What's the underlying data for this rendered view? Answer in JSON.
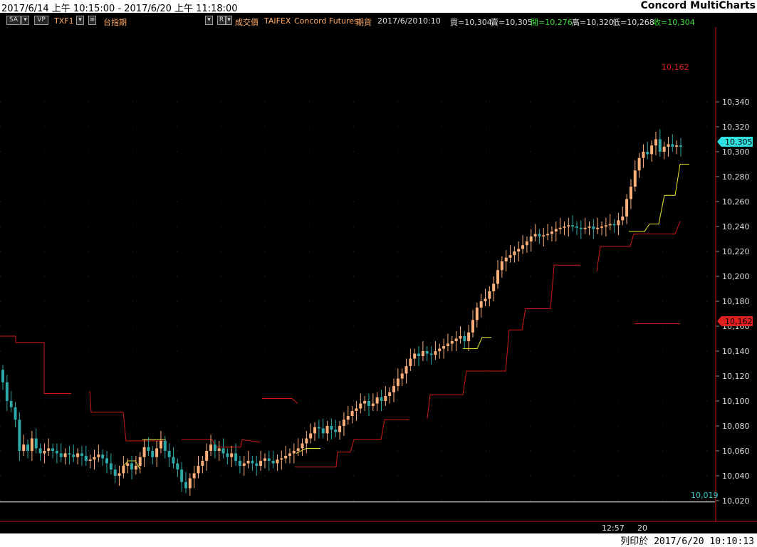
{
  "title_bar": {
    "date_range": "2017/6/14 上午 10:15:00 - 2017/6/20 上午 11:18:00",
    "app_name": "Concord MultiCharts"
  },
  "toolbar": {
    "btn_sa": "SA",
    "btn_vp": "VP",
    "symbol": "TXF1",
    "symbol_name": "台指期",
    "btn_r": "R",
    "price_type": "成交價",
    "exchange": "TAIFEX",
    "vendor": "Concord Futures",
    "category": "期貨",
    "date": "2017/6/20",
    "time": "10:10",
    "bid": "買=10,304",
    "ask": "賣=10,305",
    "open": "開=10,276",
    "high": "高=10,320",
    "low": "低=10,268",
    "close": "收=10,304"
  },
  "colors": {
    "background": "#000000",
    "up_candle": "#ffb07a",
    "down_candle": "#2ea7a7",
    "channel_red": "#d01818",
    "channel_yellow": "#e8e830",
    "price_tag": "#30e0e0",
    "level_tag": "#e02020"
  },
  "price_axis": {
    "ticks": [
      "10,340",
      "10,320",
      "10,300",
      "10,280",
      "10,260",
      "10,240",
      "10,220",
      "10,200",
      "10,180",
      "10,160",
      "10,140",
      "10,120",
      "10,100",
      "10,080",
      "10,060",
      "10,040",
      "10,020"
    ],
    "last_price_tag": "10,305",
    "level_tag": "10,162",
    "top_label": "10,162",
    "low_label": "10,019"
  },
  "time_axis": {
    "labels": [
      "12:57",
      "20"
    ]
  },
  "footer": {
    "printed_at": "列印於 2017/6/20 10:10:13"
  },
  "chart_data": {
    "type": "candlestick",
    "symbol": "TXF1",
    "ylim": [
      10018,
      10372
    ],
    "y_ticks": [
      10020,
      10040,
      10060,
      10080,
      10100,
      10120,
      10140,
      10160,
      10180,
      10200,
      10220,
      10240,
      10260,
      10280,
      10300,
      10320,
      10340
    ],
    "closes": [
      10115,
      10100,
      10095,
      10085,
      10060,
      10065,
      10060,
      10070,
      10062,
      10058,
      10060,
      10062,
      10060,
      10058,
      10055,
      10058,
      10057,
      10055,
      10058,
      10056,
      10052,
      10053,
      10055,
      10057,
      10054,
      10050,
      10045,
      10040,
      10042,
      10048,
      10050,
      10045,
      10048,
      10055,
      10063,
      10060,
      10055,
      10062,
      10068,
      10060,
      10055,
      10050,
      10045,
      10035,
      10030,
      10038,
      10042,
      10048,
      10052,
      10060,
      10065,
      10060,
      10062,
      10058,
      10055,
      10058,
      10052,
      10048,
      10050,
      10052,
      10050,
      10048,
      10052,
      10054,
      10052,
      10050,
      10053,
      10054,
      10056,
      10058,
      10060,
      10062,
      10066,
      10070,
      10074,
      10079,
      10078,
      10074,
      10080,
      10077,
      10075,
      10080,
      10085,
      10088,
      10092,
      10094,
      10098,
      10100,
      10096,
      10098,
      10103,
      10100,
      10104,
      10107,
      10112,
      10118,
      10122,
      10128,
      10134,
      10138,
      10136,
      10140,
      10138,
      10137,
      10140,
      10142,
      10144,
      10146,
      10148,
      10150,
      10152,
      10148,
      10155,
      10165,
      10175,
      10180,
      10182,
      10188,
      10194,
      10205,
      10212,
      10215,
      10217,
      10220,
      10222,
      10225,
      10228,
      10232,
      10234,
      10232,
      10233,
      10234,
      10236,
      10238,
      10239,
      10240,
      10241,
      10240,
      10239,
      10238,
      10239,
      10240,
      10238,
      10239,
      10240,
      10241,
      10242,
      10241,
      10245,
      10248,
      10262,
      10272,
      10285,
      10295,
      10300,
      10298,
      10305,
      10310,
      10300,
      10304,
      10306,
      10304,
      10305,
      10304
    ],
    "channel_upper": {
      "name": "",
      "values": []
    },
    "high_level": 10162,
    "low_level": 10019,
    "last_price": 10305
  }
}
